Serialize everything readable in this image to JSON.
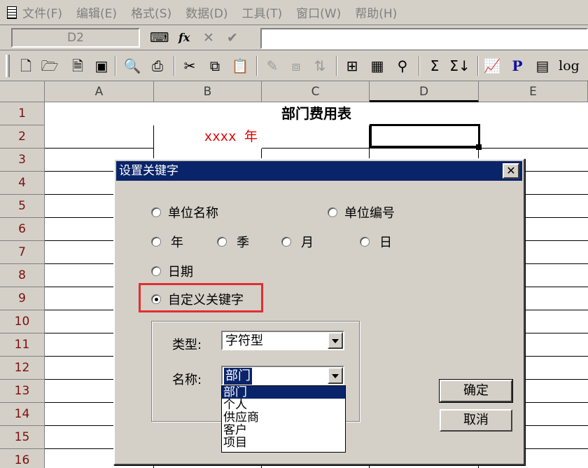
{
  "menu": [
    "文件(F)",
    "编辑(E)",
    "格式(S)",
    "数据(D)",
    "工具(T)",
    "窗口(W)",
    "帮助(H)"
  ],
  "formula_bar": {
    "name_box": "D2",
    "fx_icon": "fx",
    "formula": ""
  },
  "toolbar": {
    "icons": [
      "new-file-icon",
      "open-folder-icon",
      "document-icon",
      "save-icon",
      "print-preview-icon",
      "print-icon",
      "cut-icon",
      "copy-icon",
      "paste-icon",
      "format-painter-icon",
      "insert-sheet-icon",
      "sort-icon",
      "merge-cells-icon",
      "grid-icon",
      "find-icon",
      "sum-icon",
      "sum-down-icon",
      "chart-icon"
    ],
    "p_label": "P",
    "log_label": "log"
  },
  "sheet": {
    "columns": [
      "A",
      "B",
      "C",
      "D",
      "E"
    ],
    "selected_column": "D",
    "rows": [
      "1",
      "2",
      "3",
      "4",
      "5",
      "6",
      "7",
      "8",
      "9",
      "10",
      "11",
      "12",
      "13",
      "14",
      "15",
      "16"
    ],
    "title_cell": "部门费用表",
    "year_cell": "xxxx 年",
    "active_cell": "D2"
  },
  "dialog": {
    "title": "设置关键字",
    "close_label": "✕",
    "options": {
      "unit_name": "单位名称",
      "unit_code": "单位编号",
      "year": "年",
      "quarter": "季",
      "month": "月",
      "day": "日",
      "date": "日期",
      "custom": "自定义关键字"
    },
    "selected_option": "custom",
    "type_label": "类型:",
    "type_value": "字符型",
    "name_label": "名称:",
    "name_value": "部门",
    "name_options": [
      "部门",
      "个人",
      "供应商",
      "客户",
      "项目"
    ],
    "ok_label": "确定",
    "cancel_label": "取消"
  }
}
